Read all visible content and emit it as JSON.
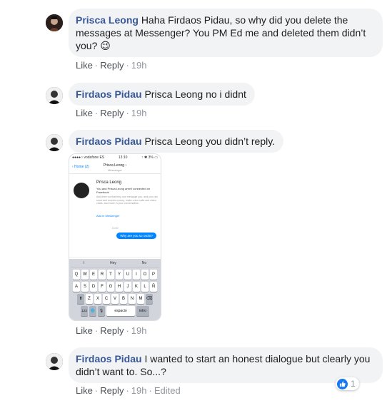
{
  "comments": [
    {
      "author": "Prisca Leong",
      "text": "Haha Firdaos Pidau, so why did you delete the messages at Messenger? You PM Ed me and deleted them didn’t you?",
      "emoji": "😉",
      "like": "Like",
      "reply": "Reply",
      "time": "19h"
    },
    {
      "author": "Firdaos Pidau",
      "text": "Prisca Leong no i didnt",
      "like": "Like",
      "reply": "Reply",
      "time": "19h"
    },
    {
      "author": "Firdaos Pidau",
      "text": "Prisca Leong you didn’t reply.",
      "like": "Like",
      "reply": "Reply",
      "time": "19h"
    },
    {
      "author": "Firdaos Pidau",
      "text": "I wanted to start an honest dialogue but clearly you didn’t want to. So...?",
      "like": "Like",
      "reply": "Reply",
      "time": "19h",
      "edited": "Edited",
      "reaction_count": "1"
    }
  ],
  "screenshot": {
    "carrier": "●●●●○ vodafone ES",
    "clock": "13:10",
    "battery": "↑ ✱ 3% ▭",
    "back": "‹ Home (2)",
    "chat_name": "Prisca Leong ›",
    "chat_sub": "Messenger",
    "profile_name": "Prisca Leong",
    "not_connected": "You and Prisca Leong aren't connected on Facebook",
    "add_desc": "Add them so that they can message you, and you can send and receive money, make voice calls and video chats, and more in your conversation.",
    "add_link": "Add in Messenger",
    "msg_time": "13:00",
    "message": "Why are you so racist?",
    "composer_placeholder": "Aa",
    "suggestions": [
      "I",
      "Hey",
      "No"
    ],
    "row1": [
      "Q",
      "W",
      "E",
      "R",
      "T",
      "Y",
      "U",
      "I",
      "O",
      "P"
    ],
    "row2": [
      "A",
      "S",
      "D",
      "F",
      "G",
      "H",
      "J",
      "K",
      "L",
      "Ñ"
    ],
    "row3": [
      "Z",
      "X",
      "C",
      "V",
      "B",
      "N",
      "M"
    ],
    "shift": "⬆",
    "backspace": "⌫",
    "numbers": "123",
    "globe": "🌐",
    "mic": "🎙",
    "space": "espacio",
    "enter": "intro"
  },
  "colors": {
    "author": "#385898",
    "bubble": "#f2f3f5",
    "messenger_blue": "#0084ff",
    "like_blue": "#1877f2"
  },
  "icons": [
    "avatar-prisca",
    "avatar-firdaos",
    "thumbs-up-icon"
  ]
}
